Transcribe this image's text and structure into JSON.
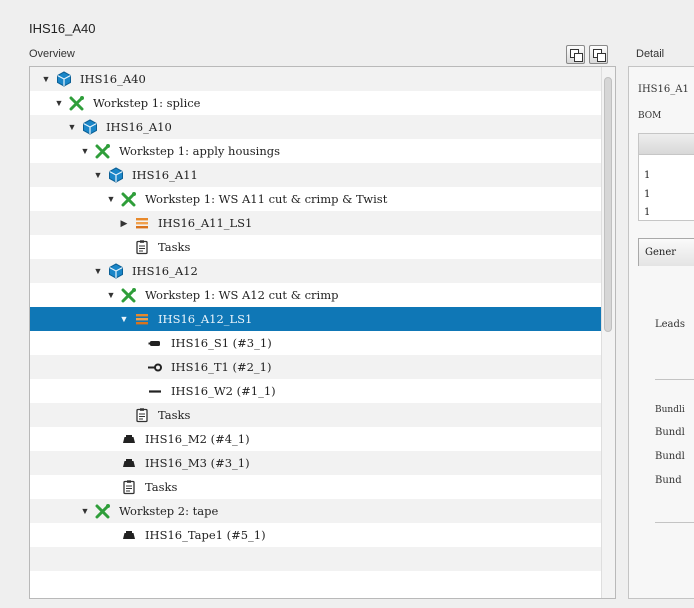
{
  "window": {
    "title": "IHS16_A40"
  },
  "overview": {
    "label": "Overview",
    "tree": [
      {
        "indent": 0,
        "expander": "▼",
        "icon": "assembly-icon",
        "label": "IHS16_A40"
      },
      {
        "indent": 1,
        "expander": "▼",
        "icon": "workstep-icon",
        "label": "Workstep 1: splice"
      },
      {
        "indent": 2,
        "expander": "▼",
        "icon": "assembly-icon",
        "label": "IHS16_A10"
      },
      {
        "indent": 3,
        "expander": "▼",
        "icon": "workstep-icon",
        "label": "Workstep 1: apply housings"
      },
      {
        "indent": 4,
        "expander": "▼",
        "icon": "assembly-icon",
        "label": "IHS16_A11"
      },
      {
        "indent": 5,
        "expander": "▼",
        "icon": "workstep-icon",
        "label": "Workstep 1: WS A11 cut & crimp & Twist"
      },
      {
        "indent": 6,
        "expander": "▶",
        "icon": "lead-set-icon",
        "label": "IHS16_A11_LS1"
      },
      {
        "indent": 6,
        "expander": "",
        "icon": "tasks-icon",
        "label": "Tasks"
      },
      {
        "indent": 4,
        "expander": "▼",
        "icon": "assembly-icon",
        "label": "IHS16_A12"
      },
      {
        "indent": 5,
        "expander": "▼",
        "icon": "workstep-icon",
        "label": "Workstep 1: WS A12 cut & crimp"
      },
      {
        "indent": 6,
        "expander": "▼",
        "icon": "lead-set-icon",
        "label": "IHS16_A12_LS1",
        "selected": true
      },
      {
        "indent": 7,
        "expander": "",
        "icon": "seal-icon",
        "label": "IHS16_S1 (#3_1)"
      },
      {
        "indent": 7,
        "expander": "",
        "icon": "terminal-icon",
        "label": "IHS16_T1 (#2_1)"
      },
      {
        "indent": 7,
        "expander": "",
        "icon": "wire-icon",
        "label": "IHS16_W2 (#1_1)"
      },
      {
        "indent": 6,
        "expander": "",
        "icon": "tasks-icon",
        "label": "Tasks"
      },
      {
        "indent": 5,
        "expander": "",
        "icon": "material-icon",
        "label": "IHS16_M2 (#4_1)"
      },
      {
        "indent": 5,
        "expander": "",
        "icon": "material-icon",
        "label": "IHS16_M3 (#3_1)"
      },
      {
        "indent": 5,
        "expander": "",
        "icon": "tasks-icon",
        "label": "Tasks"
      },
      {
        "indent": 3,
        "expander": "▼",
        "icon": "workstep-icon",
        "label": "Workstep 2: tape"
      },
      {
        "indent": 5,
        "expander": "",
        "icon": "material-icon",
        "label": "IHS16_Tape1 (#5_1)"
      },
      {
        "indent": 0,
        "expander": "",
        "icon": "",
        "label": ""
      },
      {
        "indent": 0,
        "expander": "",
        "icon": "",
        "label": ""
      }
    ]
  },
  "detail": {
    "label": "Detail",
    "name_value": "IHS16_A1",
    "bom_label": "BOM",
    "bom_rows": [
      "1",
      "1",
      "1"
    ],
    "tab_label": "Gener",
    "leads_label": "Leads",
    "bundle_labels": [
      "Bundli",
      "Bundl",
      "Bundl",
      "Bund"
    ]
  },
  "colors": {
    "selection": "#0f77b6",
    "assembly": "#1a86c8",
    "workstep": "#2f9e3a",
    "lead_set": "#e8892b"
  }
}
